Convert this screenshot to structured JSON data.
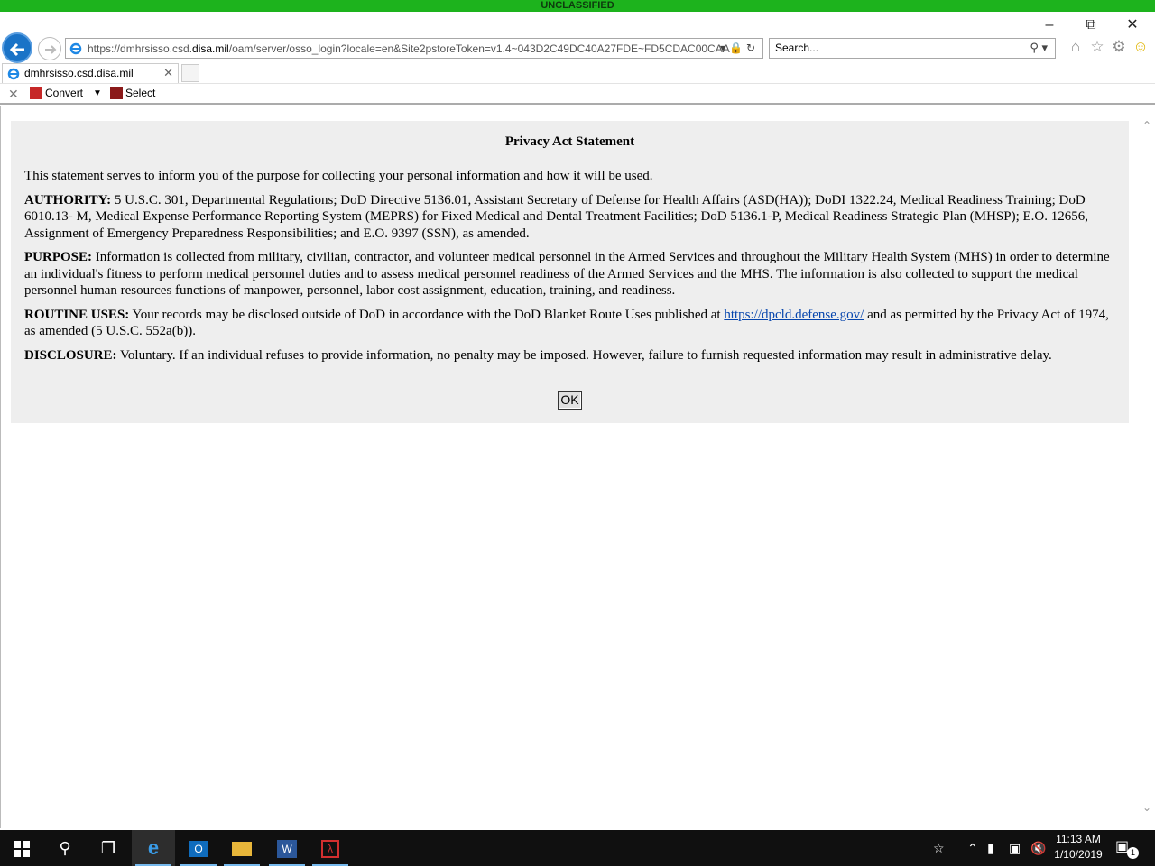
{
  "banner": {
    "text": "UNCLASSIFIED",
    "color": "#1db31d"
  },
  "window": {
    "minimize": "minimize-icon",
    "restore": "restore-icon",
    "close": "close-icon"
  },
  "toolbar": {
    "url_prefix": "https://dmhrsisso.csd.",
    "url_domain": "disa.mil",
    "url_rest": "/oam/server/osso_login?locale=en&Site2pstoreToken=v1.4~043D2C49DC40A27FDE~FD5CDAC00CAA",
    "search_placeholder": "Search..."
  },
  "tab": {
    "title": "dmhrsisso.csd.disa.mil"
  },
  "commandbar": {
    "convert_label": "Convert",
    "select_label": "Select"
  },
  "dialog": {
    "title": "Privacy Act Statement",
    "intro": "This statement serves to inform you of the purpose for collecting your personal information and how it will be used.",
    "authority_label": "AUTHORITY:",
    "authority_text": " 5 U.S.C. 301, Departmental Regulations; DoD Directive 5136.01, Assistant Secretary of Defense for Health Affairs (ASD(HA)); DoDI 1322.24, Medical Readiness Training; DoD 6010.13- M, Medical Expense Performance Reporting System (MEPRS) for Fixed Medical and Dental Treatment Facilities; DoD 5136.1-P, Medical Readiness Strategic Plan (MHSP); E.O. 12656, Assignment of Emergency Preparedness Responsibilities; and E.O. 9397 (SSN), as amended.",
    "purpose_label": "PURPOSE:",
    "purpose_text": " Information is collected from military, civilian, contractor, and volunteer medical personnel in the Armed Services and throughout the Military Health System (MHS) in order to determine an individual's fitness to perform medical personnel duties and to assess medical personnel readiness of the Armed Services and the MHS. The information is also collected to support the medical personnel human resources functions of manpower, personnel, labor cost assignment, education, training, and readiness.",
    "routine_label": "ROUTINE USES:",
    "routine_text_1": " Your records may be disclosed outside of DoD in accordance with the DoD Blanket Route Uses published at ",
    "routine_link": "https://dpcld.defense.gov/",
    "routine_text_2": " and as permitted by the Privacy Act of 1974, as amended (5 U.S.C. 552a(b)).",
    "disclosure_label": "DISCLOSURE:",
    "disclosure_text": " Voluntary. If an individual refuses to provide information, no penalty may be imposed. However, failure to furnish requested information may result in administrative delay.",
    "ok_label": "OK"
  },
  "taskbar": {
    "apps": [
      "start-icon",
      "search-icon",
      "task-view-icon",
      "internet-explorer-icon",
      "outlook-icon",
      "file-explorer-icon",
      "word-icon",
      "acrobat-icon"
    ],
    "time": "11:13 AM",
    "date": "1/10/2019",
    "notification_count": "1"
  }
}
